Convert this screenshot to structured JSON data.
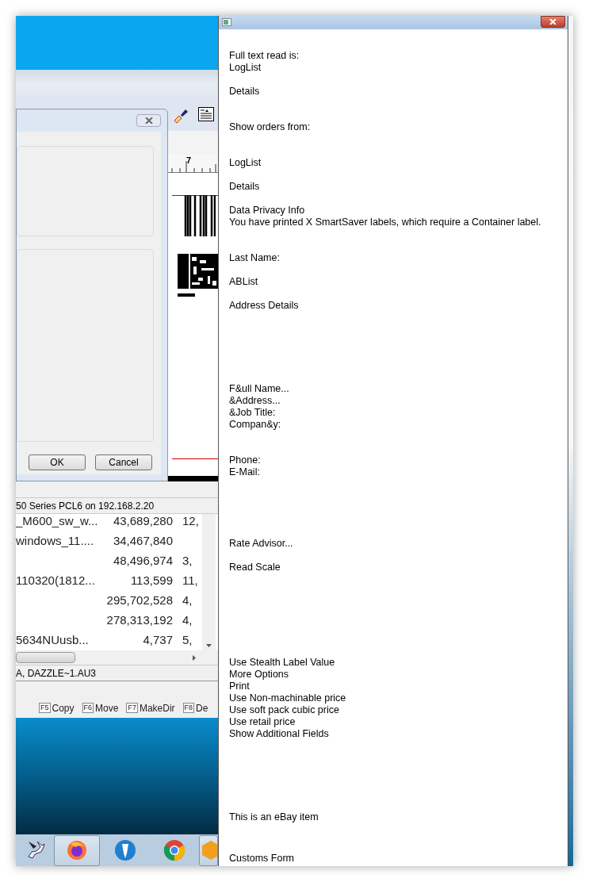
{
  "dialog": {
    "buttons": [
      "OK",
      "Cancel"
    ]
  },
  "ruler": {
    "label": "7"
  },
  "printer_status": "50 Series PCL6 on 192.168.2.20",
  "file_list": {
    "rows": [
      {
        "name": "_M600_sw_w...",
        "size": "43,689,280",
        "column_3": "12,"
      },
      {
        "name": "windows_11....",
        "size": "34,467,840"
      },
      {
        "size": "48,496,974",
        "column_3": "3,"
      },
      {
        "name": "110320(1812...",
        "size": "113,599",
        "column_3": "11,"
      },
      {
        "size": "295,702,528",
        "column_3": "4,"
      },
      {
        "size": "278,313,192",
        "column_3": "4,"
      },
      {
        "name": "5634NUusb...",
        "size": "4,737",
        "column_3": "5,"
      }
    ]
  },
  "selection_status": "A, DAZZLE~1.AU3",
  "function_keys": [
    {
      "key": "F5",
      "label": "Copy"
    },
    {
      "key": "F6",
      "label": "Move"
    },
    {
      "key": "F7",
      "label": "MakeDir"
    },
    {
      "key": "F8",
      "label": "De"
    }
  ],
  "taskbar": [
    {
      "kind": "horse",
      "selected": false
    },
    {
      "kind": "firefox",
      "selected": true
    },
    {
      "kind": "pen",
      "selected": false
    },
    {
      "kind": "chrome",
      "selected": false
    },
    {
      "kind": "app",
      "selected": true
    }
  ],
  "text_window": {
    "lines": [
      "Full text read is:",
      "LogList",
      "Details",
      "Show orders from:",
      "LogList",
      "Details",
      "Data Privacy Info",
      "You have printed X SmartSaver labels, which require a Container label.",
      "Last Name:",
      "ABList",
      "Address Details",
      "F&ull Name...",
      "&Address...",
      "&Job Title:",
      "Compan&y:",
      "Phone:",
      "E-Mail:",
      "Rate Advisor...",
      "Read Scale",
      "Use Stealth Label Value",
      "More Options",
      "Print",
      "Use Non-machinable price",
      "Use soft pack cubic price",
      "Use retail price",
      "Show Additional Fields",
      "This is an eBay item",
      "Customs Form"
    ]
  }
}
